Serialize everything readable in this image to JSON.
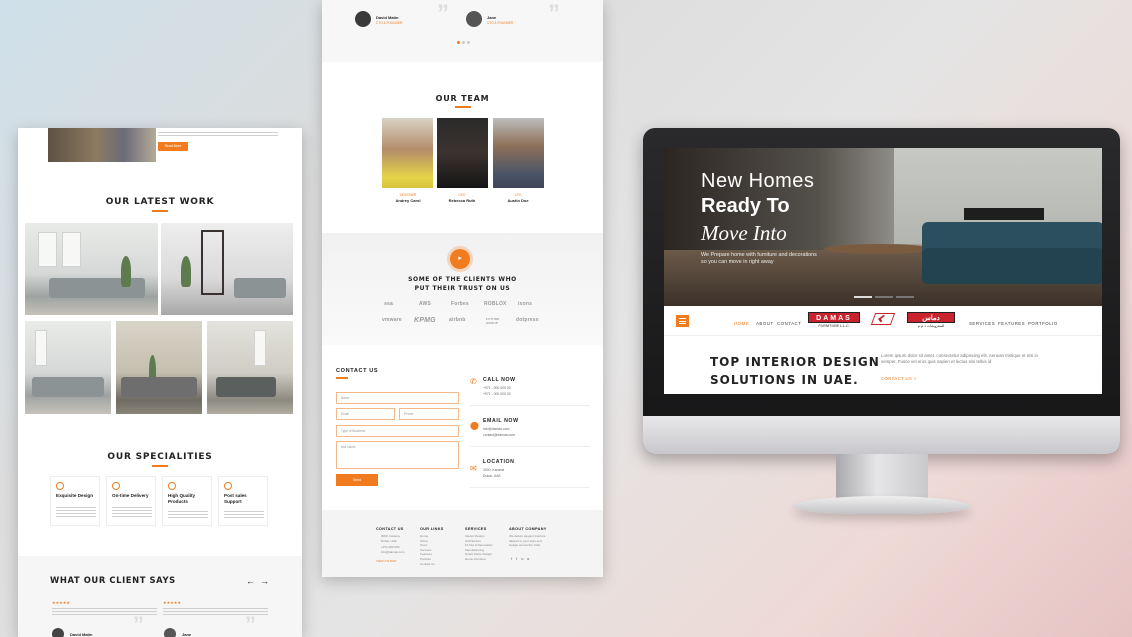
{
  "left_panel": {
    "top_button": "Read More",
    "latest_work_title": "OUR LATEST WORK",
    "specialities_title": "OUR SPECIALITIES",
    "specialities": [
      {
        "title": "Exquisite Design"
      },
      {
        "title": "On-time Delivery"
      },
      {
        "title": "High Quality Products"
      },
      {
        "title": "Post sales Support"
      }
    ],
    "testimonials_title": "WHAT OUR CLIENT SAYS",
    "prev_arrow": "←",
    "next_arrow": "→",
    "stars": "★★★★★",
    "quote_mark": "”",
    "clients": [
      {
        "name": "David Matin"
      },
      {
        "name": "Jane"
      }
    ]
  },
  "middle_panel": {
    "top_clients": [
      {
        "name": "David Matin",
        "role": "CTO & FOUNDER"
      },
      {
        "name": "Jane",
        "role": "CTO & FOUNDER"
      }
    ],
    "quote_mark": "”",
    "team_title": "OUR TEAM",
    "team": [
      {
        "role": "DESIGNER",
        "name": "Andrey Carol"
      },
      {
        "role": "CEO",
        "name": "Rebecca Ruth"
      },
      {
        "role": "CFO",
        "name": "Austin Doe"
      }
    ],
    "play_icon": "▸",
    "clients_title_line1": "SOME OF THE CLIENTS WHO",
    "clients_title_line2": "PUT THEIR TRUST ON US",
    "client_logos": [
      "ǝsa",
      "AWS",
      "Forbes",
      "ROBLOX",
      "ixons",
      "vmware",
      "KPMG",
      "airbnb",
      "FUTURE GROUP",
      "dotpress"
    ],
    "contact_title": "CONTACT US",
    "form": {
      "name": "Name",
      "email": "Email",
      "phone": "Phone",
      "business": "Type of Business",
      "message": "Ask Name",
      "submit": "Send"
    },
    "contact_info": [
      {
        "title": "CALL NOW",
        "lines": [
          "+971 - 000 000 00",
          "+971 - 000 000 00"
        ]
      },
      {
        "title": "EMAIL NOW",
        "lines": [
          "info@damas.com",
          "contact@damas.com"
        ]
      },
      {
        "title": "LOCATION",
        "lines": [
          "3000, Karama",
          "Dubai, UAE"
        ]
      }
    ],
    "footer": [
      {
        "heading": "CONTACT US",
        "lines": [
          "3000, Karama",
          "Dubai, UAE",
          "+971 000 000",
          "info@damas.com"
        ]
      },
      {
        "heading": "OUR LINKS",
        "lines": [
          "Home",
          "About",
          "Team",
          "Services",
          "Features",
          "Portfolio",
          "Contact Us"
        ]
      },
      {
        "heading": "SERVICES",
        "lines": [
          "Interior Design",
          "Architecture",
          "Fit Out & Renovation",
          "Manufacturing",
          "Smart Home Design",
          "Home Furniture"
        ]
      },
      {
        "heading": "ABOUT COMPANY",
        "lines": [
          "We deliver elegant interiors",
          "tailored to your style and",
          "budget across the UAE."
        ]
      }
    ],
    "footer_link": "VIEW ON MAP"
  },
  "monitor": {
    "hero_line1": "New Homes",
    "hero_line2": "Ready To",
    "hero_line3": "Move Into",
    "hero_sub1": "We Prepare home with furniture and decorations",
    "hero_sub2": "so you can move in right away",
    "nav_left": [
      "HOME",
      "ABOUT",
      "CONTACT"
    ],
    "nav_right": [
      "SERVICES",
      "FEATURES",
      "PORTFOLIO"
    ],
    "logo_text": "DAMAS",
    "logo_sub": "FURNITURE L.L.C.",
    "arabic_logo": "دماس",
    "arabic_sub": "للمفروشات ذ.م.م",
    "headline_line1": "TOP INTERIOR DESIGN",
    "headline_line2": "SOLUTIONS IN UAE.",
    "paragraph": "Lorem ipsum dolor sit amet, consectetur adipiscing elit. Aenean tristique et nisi in semper. Fusce vel eros quis sapien et lectus nisi tellus id",
    "cta": "CONTACT US  »"
  },
  "colors": {
    "accent": "#f07c1f",
    "dark": "#222222"
  }
}
